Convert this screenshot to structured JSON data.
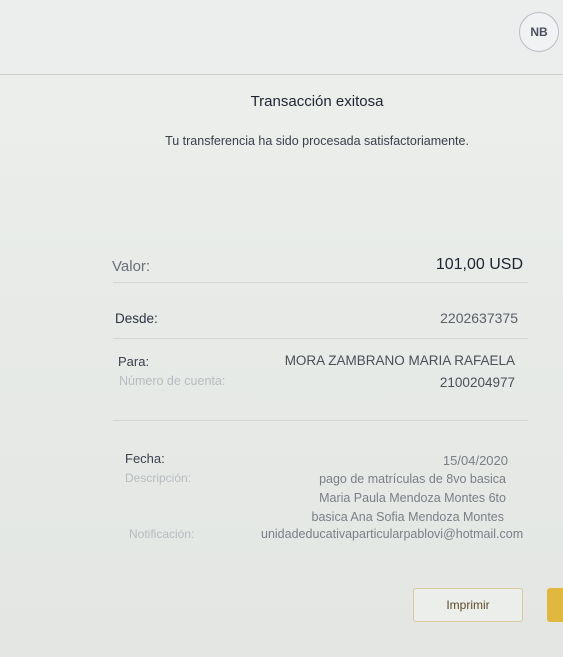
{
  "header": {
    "avatar_initials": "NB"
  },
  "receipt": {
    "title": "Transacción exitosa",
    "subtitle": "Tu transferencia ha sido procesada satisfactoriamente.",
    "valor_label": "Valor:",
    "valor_value": "101,00 USD",
    "desde_label": "Desde:",
    "desde_value": "2202637375",
    "para_label": "Para:",
    "para_value": "MORA ZAMBRANO MARIA RAFAELA",
    "cuenta_label": "Número de cuenta:",
    "cuenta_value": "2100204977",
    "fecha_label": "Fecha:",
    "fecha_value": "15/04/2020",
    "descripcion_label": "Descripción:",
    "descripcion_line1": "pago de matrículas de 8vo basica",
    "descripcion_line2": "Maria Paula Mendoza Montes 6to",
    "descripcion_line3": "basica Ana Sofia Mendoza Montes",
    "notificacion_label": "Notificación:",
    "notificacion_value": "unidadeducativaparticularpablovi@hotmail.com"
  },
  "actions": {
    "print_label": "Imprimir"
  },
  "colors": {
    "accent": "#e0b840",
    "background": "#e9ece9"
  }
}
